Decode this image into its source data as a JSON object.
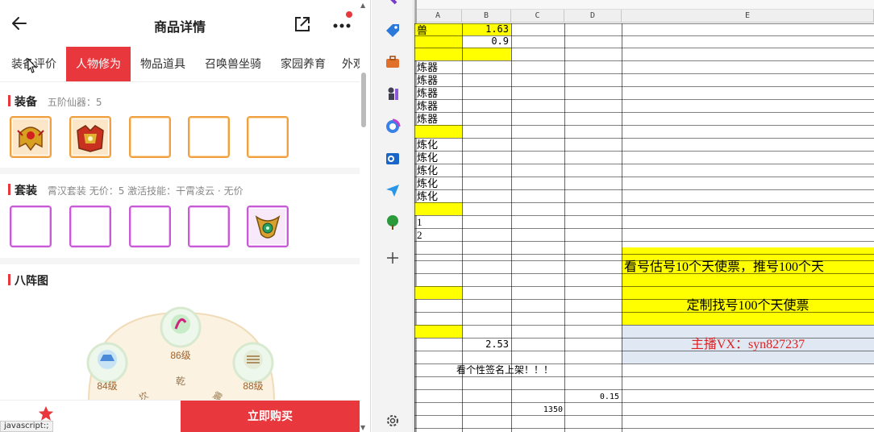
{
  "phone": {
    "title": "商品详情",
    "tabs": [
      "装备评价",
      "人物修为",
      "物品道具",
      "召唤兽坐骑",
      "家园养育",
      "外观"
    ],
    "active_tab": "人物修为",
    "equip": {
      "label": "装备",
      "sub": "五阶仙器：5"
    },
    "suit": {
      "label": "套装",
      "sub": "霄汉套装   无价：5   激活技能：干霄凌云 · 无价"
    },
    "bagua": {
      "label": "八阵图",
      "levels": [
        "86级",
        "84级",
        "88级"
      ],
      "center": "乾",
      "extra": [
        "坎",
        "震"
      ]
    },
    "buy_button": "立即购买",
    "status_text": "javascript:;"
  },
  "sheet": {
    "columns": [
      "A",
      "B",
      "C",
      "D",
      "E"
    ],
    "col_a_texts": [
      "兽",
      "",
      "",
      "炼器",
      "炼器",
      "炼器",
      "炼器",
      "炼器",
      "",
      "炼化",
      "炼化",
      "炼化",
      "炼化",
      "炼化",
      "",
      "1",
      "2",
      "",
      "",
      "",
      "",
      "",
      "",
      "",
      "",
      ""
    ],
    "b_values": {
      "row1": "1.63",
      "row2": "0.9",
      "row_total": "2.53"
    },
    "signature_note": "看个性签名上架！！！",
    "d_value": "0.15",
    "c_value": "1350",
    "banner1": "看号估号10个天使票，推号100个天",
    "banner2": "定制找号100个天使票",
    "banner3": "主播VX：syn827237",
    "colors": {
      "yellow": "#ffff00",
      "blue_box": "#dfe8f3",
      "red_text": "#e02020"
    }
  }
}
